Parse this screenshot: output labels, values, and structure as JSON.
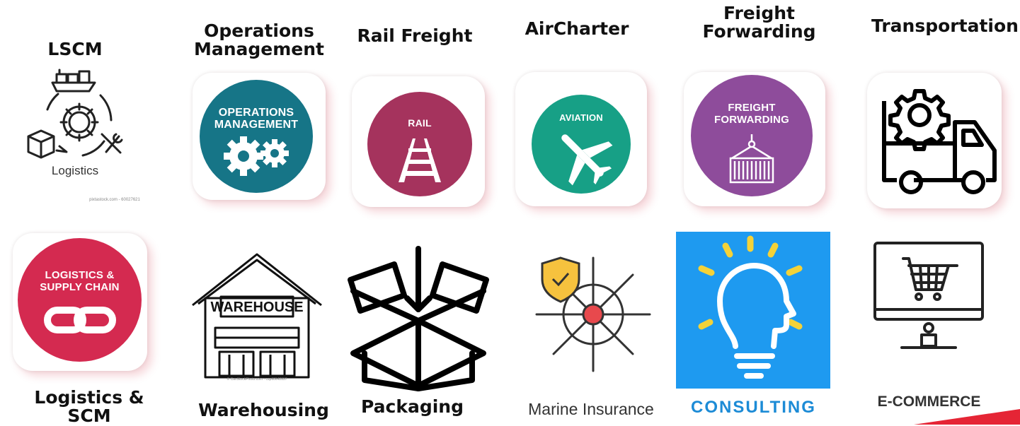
{
  "labels": {
    "lscm": "LSCM",
    "ops": [
      "Operations",
      "Management"
    ],
    "rail": "Rail Freight",
    "air": "AirCharter",
    "ff": [
      "Freight",
      "Forwarding"
    ],
    "transport": "Transportation",
    "lscm2": [
      "Logistics &",
      "SCM"
    ],
    "warehouse": "Warehousing",
    "packaging": "Packaging",
    "marine": "Marine Insurance",
    "consulting": "CONSULTING",
    "ecommerce": "E-COMMERCE"
  },
  "icons": {
    "logistics_text": "Logistics",
    "logistics_credit": "pixtastock.com - 60027621",
    "ops_text": [
      "OPERATIONS",
      "MANAGEMENT"
    ],
    "rail_text": "RAIL",
    "aviation_text": "AVIATION",
    "ff_text": [
      "FREIGHT",
      "FORWARDING"
    ],
    "lsc_text": [
      "LOGISTICS &",
      "SUPPLY CHAIN"
    ],
    "warehouse_sign": "WAREHOUSE",
    "warehouse_credit": "© CanStockPhoto.com - csp60642837"
  },
  "colors": {
    "ops": "#167587",
    "rail": "#a5335d",
    "aviation": "#17a086",
    "ff": "#8e4c9b",
    "lsc": "#d42a50",
    "consulting_bg": "#1e9af0",
    "consulting_text": "#1c8bd6",
    "bulb_rays": "#f4d238",
    "shield": "#f6c23e",
    "target": "#e8494d",
    "accent": "#e52535"
  }
}
